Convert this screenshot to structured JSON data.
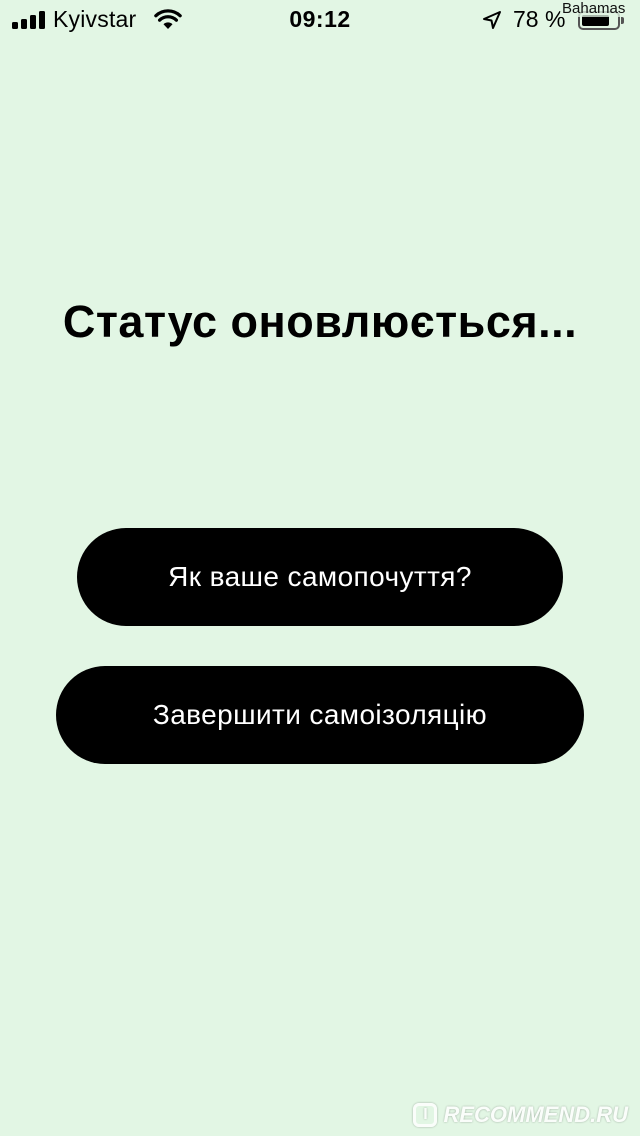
{
  "status_bar": {
    "carrier": "Kyivstar",
    "time": "09:12",
    "battery_percent": "78 %",
    "battery_level": 0.78,
    "network_label": "Bahamas",
    "icons": [
      "signal-bars-icon",
      "wifi-icon",
      "location-arrow-icon",
      "battery-icon"
    ]
  },
  "main": {
    "title": "Статус оновлюється...",
    "buttons": [
      {
        "label": "Як ваше самопочуття?"
      },
      {
        "label": "Завершити самоізоляцію"
      }
    ]
  },
  "watermark": {
    "icon_glyph": "I",
    "text": "RECOMMEND.RU"
  },
  "colors": {
    "background": "#e2f6e4",
    "button_bg": "#000000",
    "button_text": "#ffffff",
    "text": "#000000"
  }
}
